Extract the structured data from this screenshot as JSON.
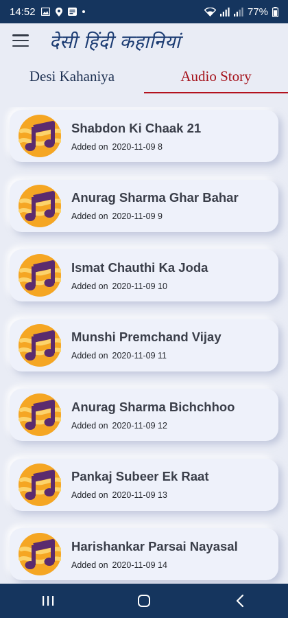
{
  "status_bar": {
    "time": "14:52",
    "battery": "77%"
  },
  "header": {
    "title": "देसी हिंदी कहानियां",
    "menu_icon": "hamburger-menu-icon"
  },
  "tabs": [
    {
      "label": "Desi Kahaniya",
      "active": false
    },
    {
      "label": "Audio Story",
      "active": true
    }
  ],
  "stories": [
    {
      "title": "Shabdon Ki Chaak 21",
      "added_label": "Added on",
      "date": "2020-11-09",
      "id": "8"
    },
    {
      "title": "Anurag Sharma Ghar Bahar",
      "added_label": "Added on",
      "date": "2020-11-09",
      "id": "9"
    },
    {
      "title": "Ismat Chauthi Ka Joda",
      "added_label": "Added on",
      "date": "2020-11-09",
      "id": "10"
    },
    {
      "title": "Munshi Premchand  Vijay",
      "added_label": "Added on",
      "date": "2020-11-09",
      "id": "11"
    },
    {
      "title": "Anurag Sharma Bichchhoo",
      "added_label": "Added on",
      "date": "2020-11-09",
      "id": "12"
    },
    {
      "title": "Pankaj Subeer Ek Raat",
      "added_label": "Added on",
      "date": "2020-11-09",
      "id": "13"
    },
    {
      "title": "Harishankar Parsai Nayasal",
      "added_label": "Added on",
      "date": "2020-11-09",
      "id": "14"
    }
  ],
  "colors": {
    "status_bar": "#15355e",
    "active_tab": "#a5121b",
    "icon_orange": "#f5a623",
    "icon_purple": "#5b2b6e"
  }
}
